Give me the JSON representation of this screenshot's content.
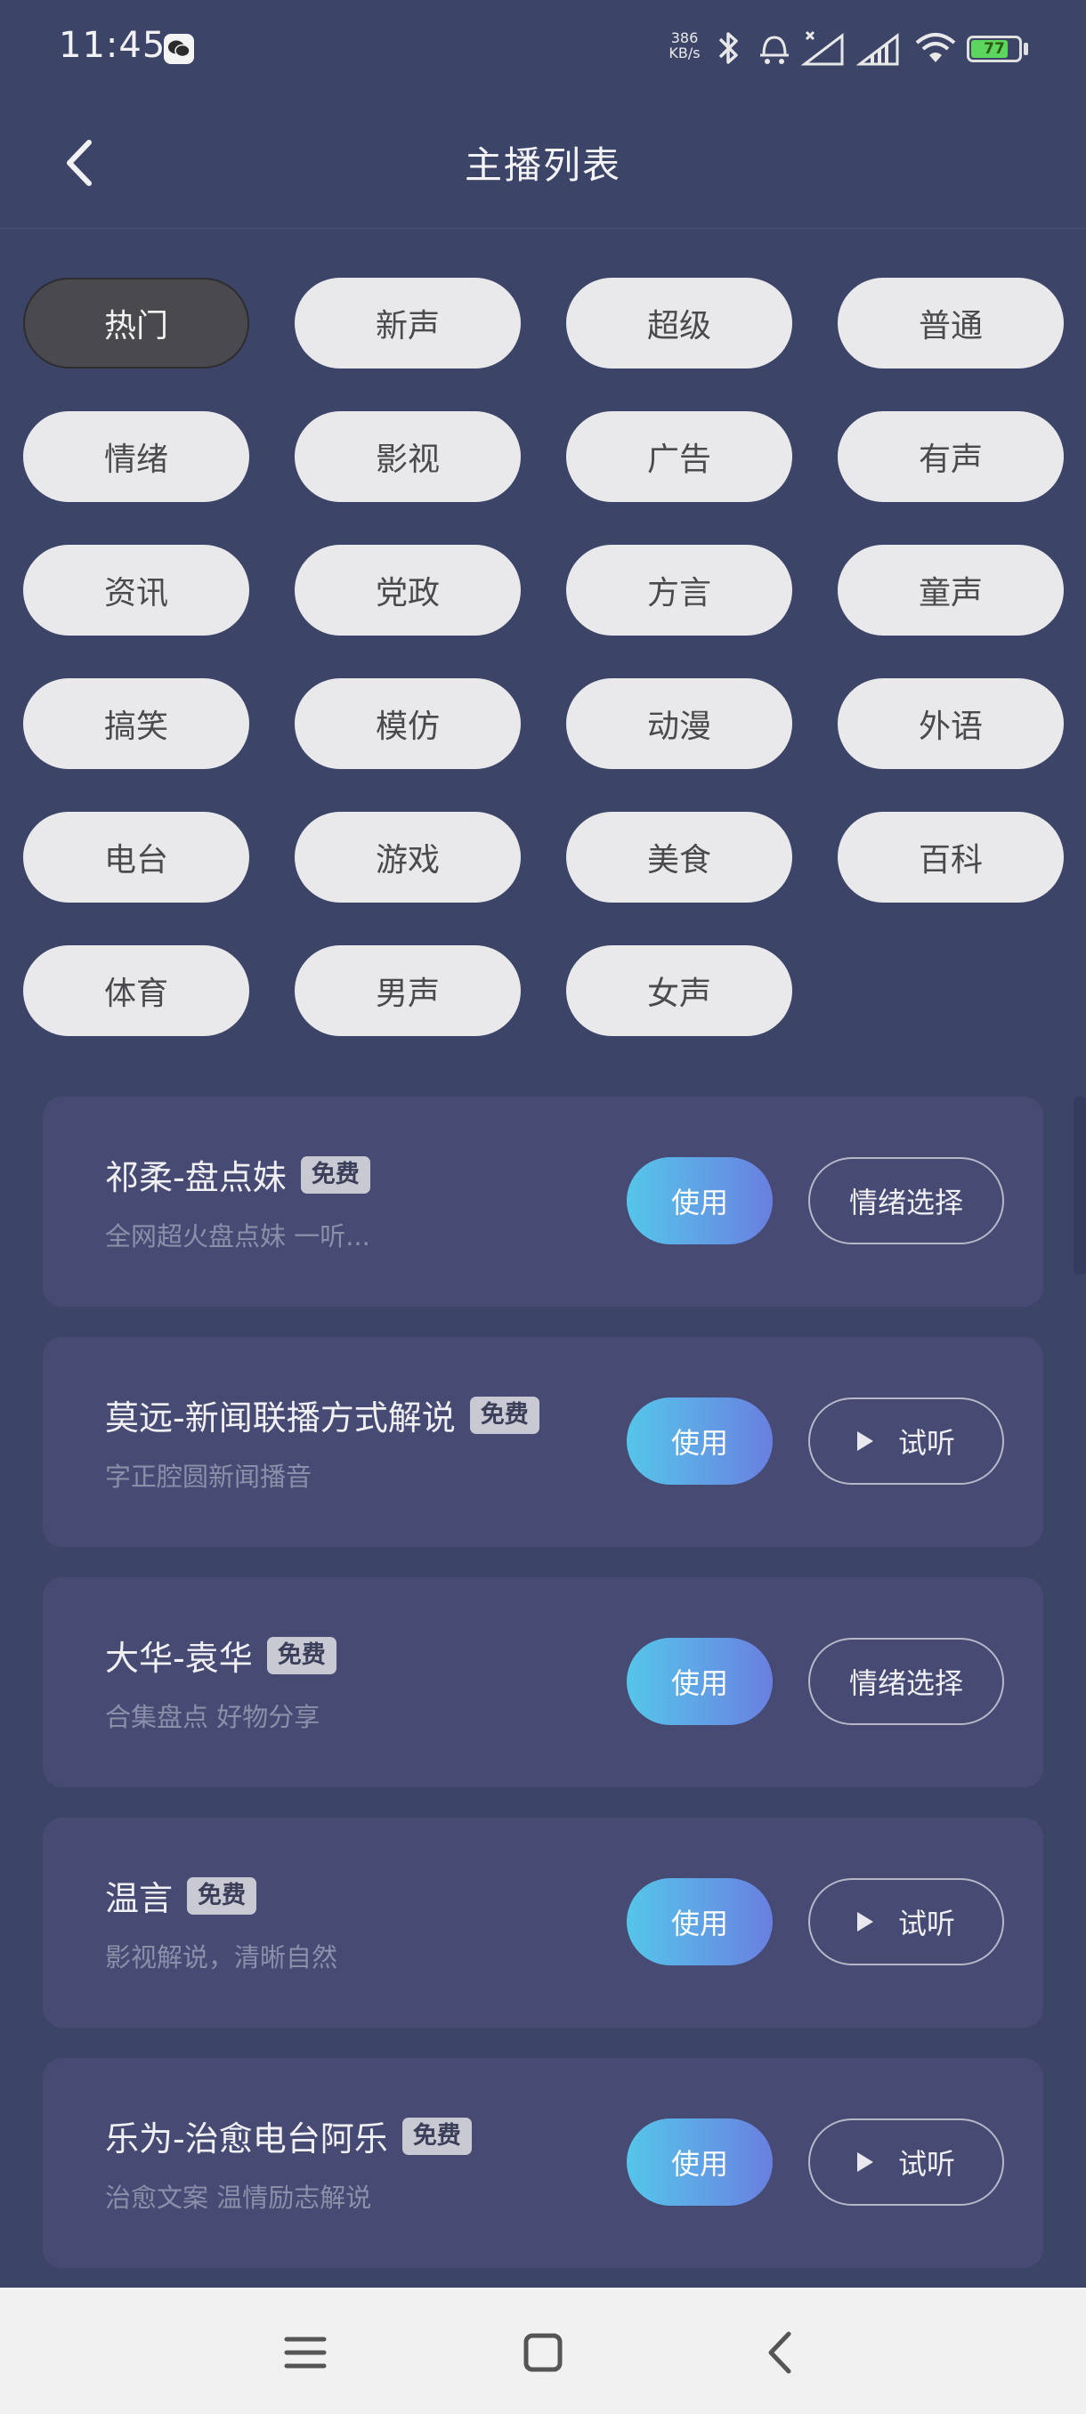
{
  "status_bar": {
    "time": "11:45",
    "net_speed_value": "386",
    "net_speed_unit": "KB/s",
    "battery": "77",
    "icons": [
      "wechat-icon",
      "bluetooth-icon",
      "alarm-icon",
      "signal-icon",
      "signal-icon",
      "wifi-icon",
      "battery-icon"
    ]
  },
  "header": {
    "title": "主播列表",
    "back_icon": "chevron-left-icon"
  },
  "categories": {
    "selected": "热门",
    "items": [
      "热门",
      "新声",
      "超级",
      "普通",
      "情绪",
      "影视",
      "广告",
      "有声",
      "资讯",
      "党政",
      "方言",
      "童声",
      "搞笑",
      "模仿",
      "动漫",
      "外语",
      "电台",
      "游戏",
      "美食",
      "百科",
      "体育",
      "男声",
      "女声"
    ]
  },
  "anchors": [
    {
      "name": "祁柔-盘点妹",
      "badge": "免费",
      "desc": "全网超火盘点妹 一听...",
      "use_label": "使用",
      "action_label": "情绪选择",
      "action_icon": ""
    },
    {
      "name": "莫远-新闻联播方式解说",
      "badge": "免费",
      "desc": "字正腔圆新闻播音",
      "use_label": "使用",
      "action_label": "试听",
      "action_icon": "play-icon"
    },
    {
      "name": "大华-袁华",
      "badge": "免费",
      "desc": "合集盘点 好物分享",
      "use_label": "使用",
      "action_label": "情绪选择",
      "action_icon": ""
    },
    {
      "name": "温言",
      "badge": "免费",
      "desc": "影视解说，清晰自然",
      "use_label": "使用",
      "action_label": "试听",
      "action_icon": "play-icon"
    },
    {
      "name": "乐为-治愈电台阿乐",
      "badge": "免费",
      "desc": "治愈文案 温情励志解说",
      "use_label": "使用",
      "action_label": "试听",
      "action_icon": "play-icon"
    }
  ],
  "nav_bar": {
    "icons": [
      "menu-icon",
      "home-icon",
      "back-icon"
    ]
  },
  "colors": {
    "background": "#3c4468",
    "card": "#474b73",
    "chip": "#e9e9ec",
    "chip_active": "#4a4a4e",
    "use_gradient_start": "#55c6ea",
    "use_gradient_end": "#6a7fe0"
  }
}
